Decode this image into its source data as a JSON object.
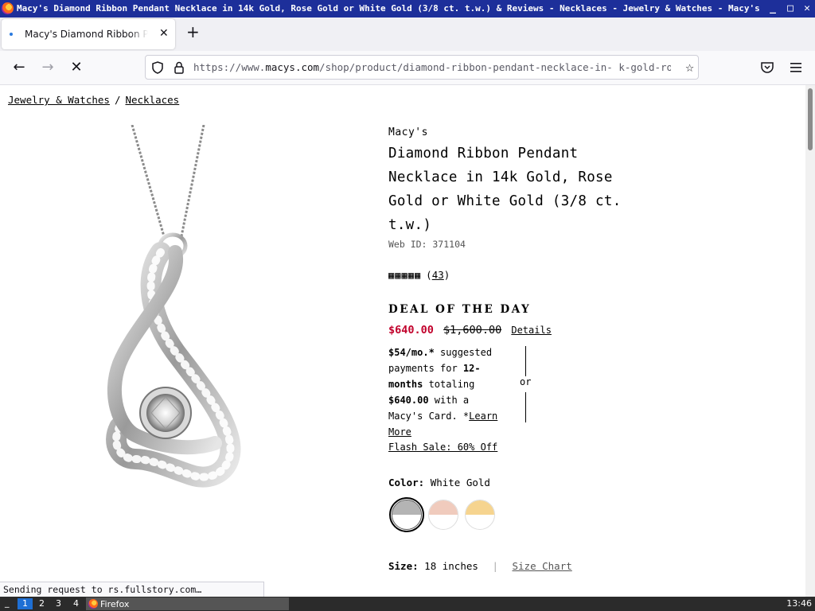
{
  "window": {
    "title": "Macy's Diamond Ribbon Pendant Necklace in 14k Gold, Rose Gold or White Gold (3/8 ct. t.w.) & Reviews - Necklaces - Jewelry & Watches - Macy's — Mozilla Firefox",
    "minimize": "_",
    "maximize": "□",
    "close": "✕"
  },
  "tab": {
    "label": "Macy's Diamond Ribbon Pendant Necklace",
    "close": "✕",
    "new_tab": "+"
  },
  "nav": {
    "back": "←",
    "forward": "→",
    "stop": "✕",
    "url_prefix": "https://www.",
    "url_host": "macys.com",
    "url_path": "/shop/product/diamond-ribbon-pendant-necklace-in-    k-gold-rose-"
  },
  "breadcrumb": {
    "items": [
      "Jewelry & Watches",
      "Necklaces"
    ],
    "separator": "/"
  },
  "product": {
    "brand": "Macy's",
    "title": "Diamond Ribbon Pendant Necklace in 14k Gold, Rose Gold or White Gold (3/8 ct. t.w.)",
    "web_id": "Web ID: 371104",
    "rating_stars": 5,
    "review_count": "43",
    "deal": "DEAL OF THE DAY",
    "sale_price": "$640.00",
    "original_price": "$1,600.00",
    "details_link": "Details",
    "payment": {
      "monthly": "$54/mo.*",
      "text1": " suggested payments for ",
      "months": "12-months",
      "text2": " totaling ",
      "total": "$640.00",
      "text3": " with a Macy's Card. *",
      "learn_more": "Learn More",
      "or": "or"
    },
    "flash_sale": "Flash Sale: 60% Off",
    "color_label": "Color:",
    "color_value": "White Gold",
    "swatches": [
      {
        "name": "White Gold",
        "color": "#b4b4b4"
      },
      {
        "name": "Rose Gold",
        "color": "#f0cbbd"
      },
      {
        "name": "Yellow Gold",
        "color": "#f6d48f"
      }
    ],
    "size_label": "Size:",
    "size_value": "18 inches",
    "size_chart": "Size Chart"
  },
  "status": {
    "text": "Sending request to rs.fullstory.com…"
  },
  "taskbar": {
    "menu": "_",
    "workspaces": [
      "1",
      "2",
      "3",
      "4"
    ],
    "active_workspace": 0,
    "app": "Firefox",
    "clock": "13:46"
  }
}
